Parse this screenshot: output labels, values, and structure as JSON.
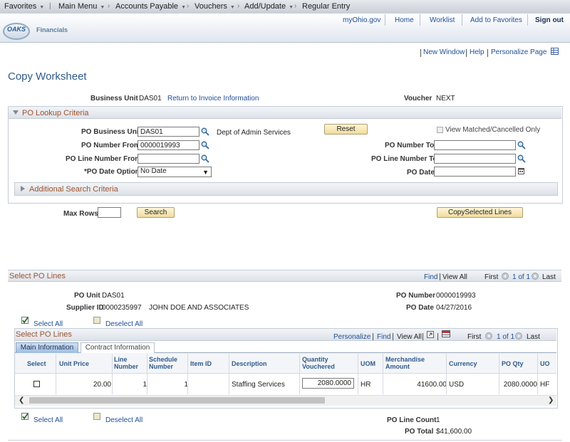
{
  "nav": {
    "favorites": "Favorites",
    "main_menu": "Main Menu",
    "crumbs": [
      "Accounts Payable",
      "Vouchers",
      "Add/Update",
      "Regular Entry"
    ]
  },
  "header": {
    "logo_oaks": "OAKS",
    "logo_financials": "Financials",
    "links": [
      "myOhio.gov",
      "Home",
      "Worklist",
      "Add to Favorites",
      "Sign out"
    ]
  },
  "toplinks": {
    "new_window": "New Window",
    "help": "Help",
    "personalize_page": "Personalize Page"
  },
  "page_title": "Copy Worksheet",
  "business_unit": {
    "label": "Business Unit",
    "value": "DAS01",
    "return_link": "Return to Invoice Information"
  },
  "voucher": {
    "label": "Voucher",
    "value": "NEXT"
  },
  "lookup": {
    "title": "PO Lookup Criteria",
    "po_business_unit_label": "PO Business Unit",
    "po_business_unit_value": "DAS01",
    "po_business_unit_desc": "Dept of Admin Services",
    "reset": "Reset",
    "view_matched": "View Matched/Cancelled Only",
    "po_number_from_label": "PO Number From",
    "po_number_from_value": "0000019993",
    "po_number_to_label": "PO Number To",
    "po_line_from_label": "PO Line Number From",
    "po_line_to_label": "PO Line Number To",
    "po_date_option_label": "*PO Date Option",
    "po_date_option_value": "No Date",
    "po_date_label": "PO Date",
    "additional": "Additional Search Criteria"
  },
  "max_rows_label": "Max Rows",
  "search_btn": "Search",
  "copy_btn": "CopySelected Lines",
  "select_po": {
    "title": "Select PO Lines",
    "find": "Find",
    "view_all": "View All",
    "first": "First",
    "range": "1 of 1",
    "last": "Last",
    "po_unit_label": "PO Unit",
    "po_unit_value": "DAS01",
    "po_number_label": "PO Number",
    "po_number_value": "0000019993",
    "supplier_label": "Supplier ID",
    "supplier_id": "0000235997",
    "supplier_name": "JOHN DOE AND ASSOCIATES",
    "po_date_label": "PO Date",
    "po_date_value": "04/27/2016",
    "select_all": "Select All",
    "deselect_all": "Deselect All"
  },
  "grid": {
    "title": "Select PO Lines",
    "personalize": "Personalize",
    "find": "Find",
    "view_all": "View All",
    "first": "First",
    "range": "1 of 1",
    "last": "Last",
    "tabs": [
      "Main Information",
      "Contract Information"
    ],
    "columns": [
      [
        "Select"
      ],
      [
        "Unit Price"
      ],
      [
        "Line",
        "Number"
      ],
      [
        "Schedule",
        "Number"
      ],
      [
        "Item ID"
      ],
      [
        "Description"
      ],
      [
        "Quantity",
        "Vouchered"
      ],
      [
        "UOM"
      ],
      [
        "Merchandise",
        "Amount"
      ],
      [
        "Currency"
      ],
      [
        "PO Qty"
      ],
      [
        "UO"
      ]
    ],
    "row": {
      "unit_price": "20.00",
      "line": "1",
      "schedule": "1",
      "item_id": "",
      "description": "Staffing Services",
      "qty_vouchered": "2080.0000",
      "uom": "HR",
      "merch_amount": "41600.00",
      "currency": "USD",
      "po_qty": "2080.0000",
      "uo": "HF"
    }
  },
  "footer": {
    "select_all": "Select All",
    "deselect_all": "Deselect All",
    "po_line_count_label": "PO Line Count",
    "po_line_count_value": "1",
    "po_total_label": "PO Total",
    "po_total_value": "$41,600.00"
  }
}
